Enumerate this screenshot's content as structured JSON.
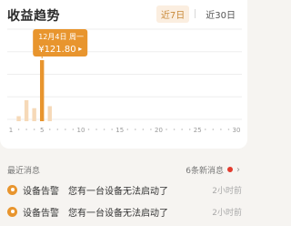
{
  "header": {
    "title": "收益趋势"
  },
  "tabs": [
    {
      "label": "近7日",
      "active": true
    },
    {
      "label": "近30日",
      "active": false
    }
  ],
  "tooltip": {
    "date": "12月4日 周一",
    "value": "¥121.80",
    "arrow": "▸"
  },
  "colors": {
    "accent": "#e8952e",
    "bar": "#f6d9b8",
    "red": "#e23b2e"
  },
  "chart_data": {
    "type": "bar",
    "x": [
      1,
      2,
      3,
      4,
      5,
      6,
      7,
      8,
      9,
      10,
      11,
      12,
      13,
      14,
      15,
      16,
      17,
      18,
      19,
      20,
      21,
      22,
      23,
      24,
      25,
      26,
      27,
      28,
      29,
      30
    ],
    "values": [
      0,
      10,
      42,
      26,
      121.8,
      30,
      0,
      0,
      0,
      0,
      0,
      0,
      0,
      0,
      0,
      0,
      0,
      0,
      0,
      0,
      0,
      0,
      0,
      0,
      0,
      0,
      0,
      0,
      0,
      0
    ],
    "highlight_index": 4,
    "tick_labels": [
      "1",
      "5",
      "10",
      "15",
      "20",
      "25",
      "30"
    ],
    "tick_positions": [
      1,
      5,
      10,
      15,
      20,
      25,
      30
    ],
    "ylim": [
      0,
      180
    ],
    "grid": true
  },
  "messages": {
    "title": "最近消息",
    "count_label": "6条新消息",
    "items": [
      {
        "type": "设备告警",
        "text": "您有一台设备无法启动了",
        "time": "2小时前"
      },
      {
        "type": "设备告警",
        "text": "您有一台设备无法启动了",
        "time": "2小时前"
      }
    ]
  }
}
